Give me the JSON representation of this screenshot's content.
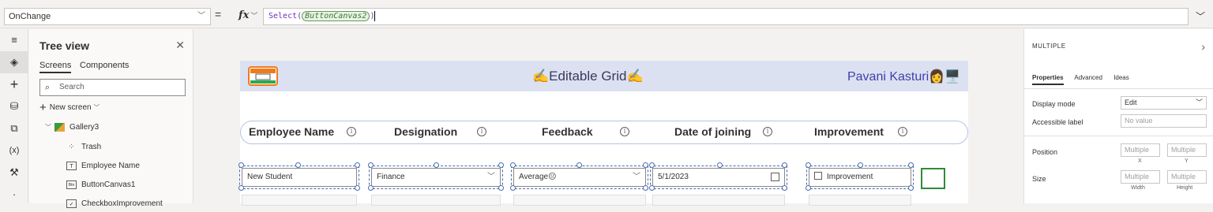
{
  "formula_bar": {
    "property": "OnChange",
    "equals": "=",
    "fx_label": "fx",
    "formula_prefix": "Select(",
    "formula_arg": "ButtonCanvas2",
    "formula_suffix": ")"
  },
  "left_rail": {
    "icons": [
      "hamburger-icon",
      "layers-icon",
      "insert-icon",
      "data-icon",
      "media-icon",
      "variables-icon",
      "tools-icon"
    ]
  },
  "tree_view": {
    "title": "Tree view",
    "tabs": [
      "Screens",
      "Components"
    ],
    "search_placeholder": "Search",
    "new_screen": "New screen",
    "items": [
      {
        "label": "Gallery3",
        "icon": "gallery-icon"
      },
      {
        "label": "Trash",
        "icon": "icon-control-icon"
      },
      {
        "label": "Employee Name",
        "icon": "text-input-icon"
      },
      {
        "label": "ButtonCanvas1",
        "icon": "button-icon"
      },
      {
        "label": "CheckboxImprovement",
        "icon": "checkbox-icon"
      }
    ]
  },
  "app": {
    "title": "✍️Editable Grid✍️",
    "user": "Pavani Kasturi👩🖥️",
    "columns": [
      "Employee Name",
      "Designation",
      "Feedback",
      "Date of joining",
      "Improvement"
    ],
    "row1": {
      "name": "New Student",
      "designation": "Finance",
      "feedback": "Average😐",
      "date": "5/1/2023",
      "improvement": "Improvement"
    }
  },
  "properties": {
    "header": "MULTIPLE",
    "tabs": [
      "Properties",
      "Advanced",
      "Ideas"
    ],
    "display_mode_label": "Display mode",
    "display_mode_value": "Edit",
    "accessible_label": "Accessible label",
    "accessible_value": "No value",
    "position_label": "Position",
    "position_x": "Multiple",
    "position_y": "Multiple",
    "x_label": "X",
    "y_label": "Y",
    "size_label": "Size",
    "size_w": "Multiple",
    "size_h": "Multiple",
    "width_label": "Width",
    "height_label": "Height"
  }
}
